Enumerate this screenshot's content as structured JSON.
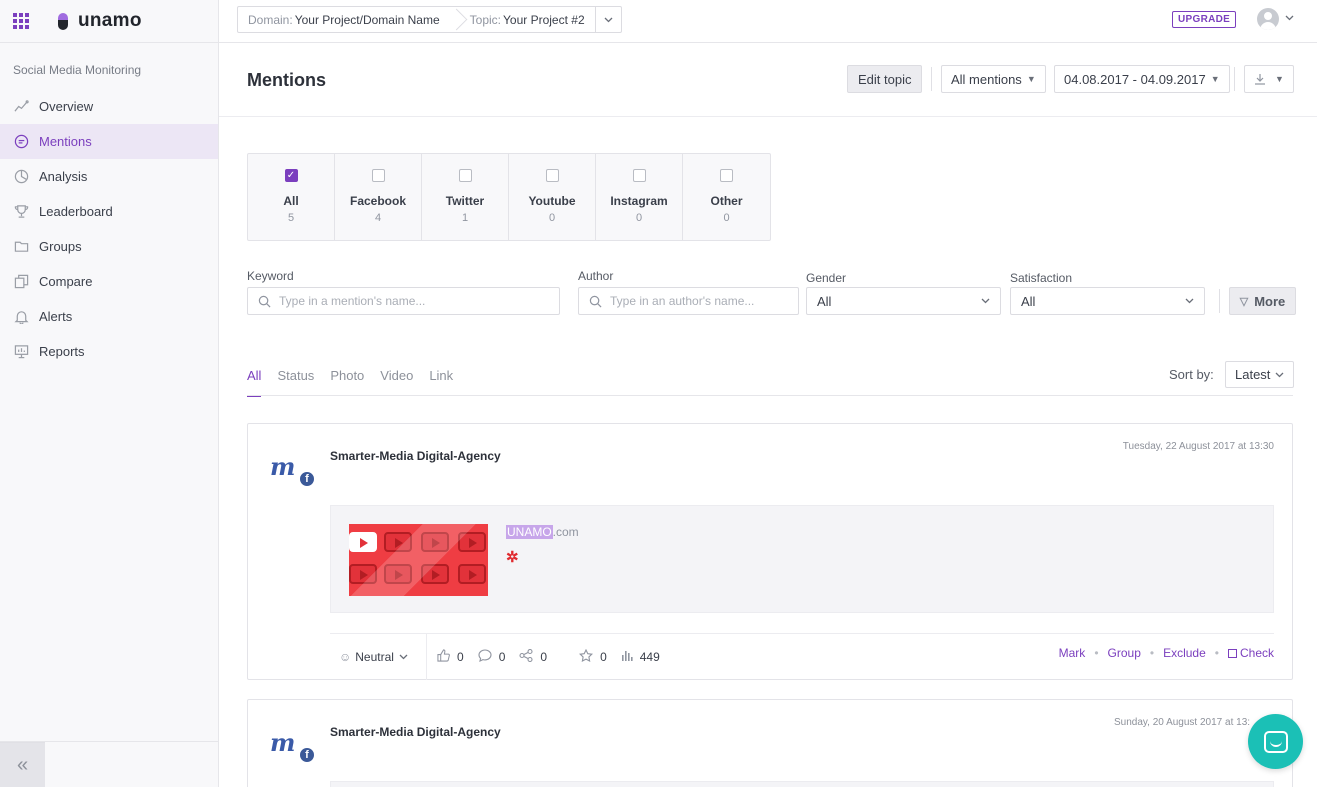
{
  "app": {
    "brand": "unamo"
  },
  "sidebar": {
    "section": "Social Media Monitoring",
    "items": [
      {
        "label": "Overview",
        "icon": "trend-icon",
        "active": false
      },
      {
        "label": "Mentions",
        "icon": "chat-bubble-icon",
        "active": true
      },
      {
        "label": "Analysis",
        "icon": "pie-icon",
        "active": false
      },
      {
        "label": "Leaderboard",
        "icon": "trophy-icon",
        "active": false
      },
      {
        "label": "Groups",
        "icon": "folder-icon",
        "active": false
      },
      {
        "label": "Compare",
        "icon": "copy-icon",
        "active": false
      },
      {
        "label": "Alerts",
        "icon": "bell-icon",
        "active": false
      },
      {
        "label": "Reports",
        "icon": "presentation-icon",
        "active": false
      }
    ],
    "collapse_glyph": "«"
  },
  "topbar": {
    "domain_label": "Domain:",
    "domain_value": "Your Project/Domain Name",
    "topic_label": "Topic:",
    "topic_value": "Your Project #2",
    "upgrade": "UPGRADE"
  },
  "header": {
    "title": "Mentions",
    "edit_topic": "Edit topic",
    "mentions_filter": "All mentions",
    "date_range": "04.08.2017 - 04.09.2017"
  },
  "sources": [
    {
      "name": "All",
      "count": "5",
      "checked": true
    },
    {
      "name": "Facebook",
      "count": "4",
      "checked": false
    },
    {
      "name": "Twitter",
      "count": "1",
      "checked": false
    },
    {
      "name": "Youtube",
      "count": "0",
      "checked": false
    },
    {
      "name": "Instagram",
      "count": "0",
      "checked": false
    },
    {
      "name": "Other",
      "count": "0",
      "checked": false
    }
  ],
  "filters": {
    "keyword_label": "Keyword",
    "keyword_placeholder": "Type in a mention's name...",
    "author_label": "Author",
    "author_placeholder": "Type in an author's name...",
    "gender_label": "Gender",
    "gender_value": "All",
    "satisfaction_label": "Satisfaction",
    "satisfaction_value": "All",
    "more": "More"
  },
  "tabs": [
    "All",
    "Status",
    "Photo",
    "Video",
    "Link"
  ],
  "sort": {
    "label": "Sort by:",
    "value": "Latest"
  },
  "mentions": [
    {
      "author": "Smarter-Media Digital-Agency",
      "date": "Tuesday, 22 August 2017 at 13:30",
      "site_highlight": "UNAMO",
      "site_rest": ".com",
      "sentiment": "Neutral",
      "likes": "0",
      "comments": "0",
      "shares": "0",
      "stars": "0",
      "reach": "449",
      "actions": {
        "mark": "Mark",
        "group": "Group",
        "exclude": "Exclude",
        "check": "Check"
      }
    },
    {
      "author": "Smarter-Media Digital-Agency",
      "date": "Sunday, 20 August 2017 at 13:"
    }
  ],
  "colors": {
    "accent": "#7b3fbe",
    "chat": "#1bc0b6",
    "facebook": "#3b5998"
  }
}
